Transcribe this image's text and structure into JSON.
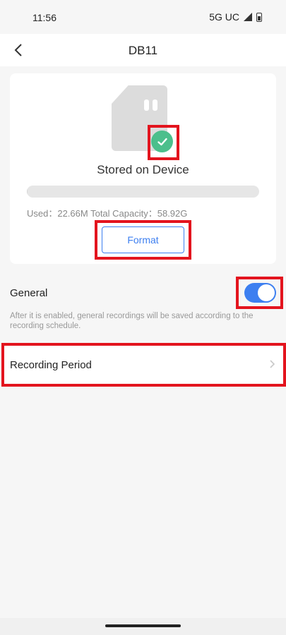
{
  "status_bar": {
    "time": "11:56",
    "network": "5G UC",
    "icons": [
      "signal-icon",
      "battery-icon"
    ]
  },
  "header": {
    "title": "DB11",
    "back_icon": "chevron-left-icon"
  },
  "storage": {
    "status": "Stored on Device",
    "status_icon": "check-circle-icon",
    "device_icon": "sd-card-icon",
    "usage_text": "Used：22.66M Total Capacity：58.92G",
    "used_fraction": 0.0004,
    "format_label": "Format"
  },
  "general": {
    "label": "General",
    "enabled": true,
    "description": "After it is enabled, general recordings will be saved according to the recording schedule."
  },
  "recording_period": {
    "label": "Recording Period",
    "icon": "chevron-right-icon"
  },
  "colors": {
    "accent": "#3d7ff0",
    "success": "#4cbf8c",
    "highlight": "#e3141e"
  }
}
